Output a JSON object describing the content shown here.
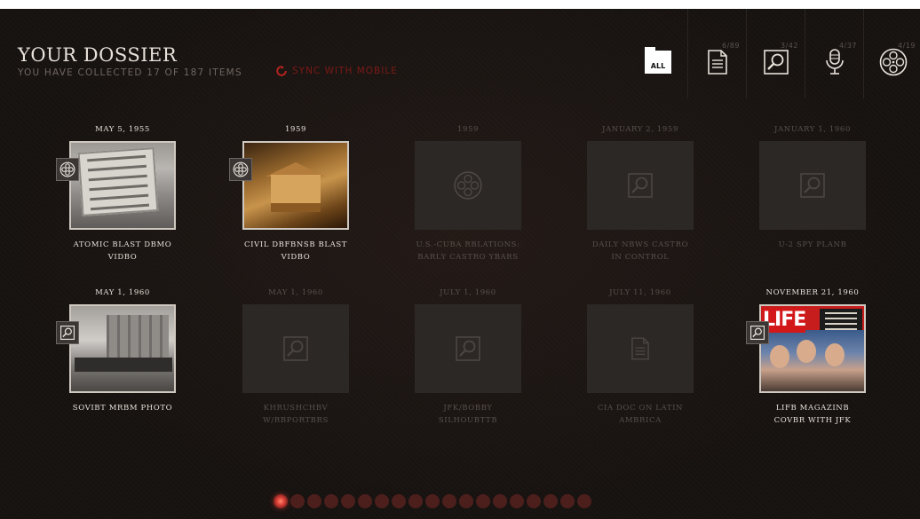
{
  "header": {
    "title": "YOUR DOSSIER",
    "subtitle": "YOU HAVE COLLECTED 17 OF 187 ITEMS",
    "sync_label": "SYNC WITH MOBILE"
  },
  "filters": [
    {
      "id": "all",
      "label": "ALL",
      "count": "",
      "icon": "folder-icon",
      "selected": true
    },
    {
      "id": "documents",
      "label": "",
      "count": "6/89",
      "icon": "document-icon",
      "selected": false
    },
    {
      "id": "photos",
      "label": "",
      "count": "3/42",
      "icon": "magnifier-photo-icon",
      "selected": false
    },
    {
      "id": "audio",
      "label": "",
      "count": "4/37",
      "icon": "microphone-icon",
      "selected": false
    },
    {
      "id": "video",
      "label": "",
      "count": "4/19",
      "icon": "film-reel-icon",
      "selected": false
    }
  ],
  "items": [
    {
      "date": "MAY 5, 1955",
      "title_line1": "ATOMIC BLAST DBMO",
      "title_line2": "VIDBO",
      "type": "video",
      "icon": "film-reel-icon",
      "unlocked": true
    },
    {
      "date": "1959",
      "title_line1": "CIVIL DBFBNSB BLAST",
      "title_line2": "VIDBO",
      "type": "video",
      "icon": "film-reel-icon",
      "unlocked": true
    },
    {
      "date": "1959",
      "title_line1": "U.S.-CUBA RBLATIONS:",
      "title_line2": "BARLY CASTRO YBARS",
      "type": "video",
      "icon": "film-reel-icon",
      "unlocked": false
    },
    {
      "date": "JANUARY 2, 1959",
      "title_line1": "DAILY NBWS CASTRO",
      "title_line2": "IN CONTROL",
      "type": "photo",
      "icon": "magnifier-photo-icon",
      "unlocked": false
    },
    {
      "date": "JANUARY 1, 1960",
      "title_line1": "U-2 SPY PLANB",
      "title_line2": "",
      "type": "photo",
      "icon": "magnifier-photo-icon",
      "unlocked": false
    },
    {
      "date": "MAY 1, 1960",
      "title_line1": "SOVIBT MRBM PHOTO",
      "title_line2": "",
      "type": "photo",
      "icon": "magnifier-photo-icon",
      "unlocked": true
    },
    {
      "date": "MAY 1, 1960",
      "title_line1": "KHRUSHCHBV",
      "title_line2": "W/RBPORTBRS",
      "type": "photo",
      "icon": "magnifier-photo-icon",
      "unlocked": false
    },
    {
      "date": "JULY 1, 1960",
      "title_line1": "JFK/BOBBY",
      "title_line2": "SILHOUBTTB",
      "type": "photo",
      "icon": "magnifier-photo-icon",
      "unlocked": false
    },
    {
      "date": "JULY 11, 1960",
      "title_line1": "CIA DOC ON LATIN",
      "title_line2": "AMBRICA",
      "type": "document",
      "icon": "document-icon",
      "unlocked": false
    },
    {
      "date": "NOVEMBER 21, 1960",
      "title_line1": "LIFB MAGAZINB",
      "title_line2": "COVBR WITH JFK",
      "type": "photo",
      "icon": "magnifier-photo-icon",
      "unlocked": true
    }
  ],
  "life_logo": "LIFE",
  "pagination": {
    "total_pages": 19,
    "current_page": 1
  },
  "colors": {
    "accent": "#c0392b",
    "text": "#e6e0d8",
    "muted": "#57504b",
    "background": "#161210"
  }
}
